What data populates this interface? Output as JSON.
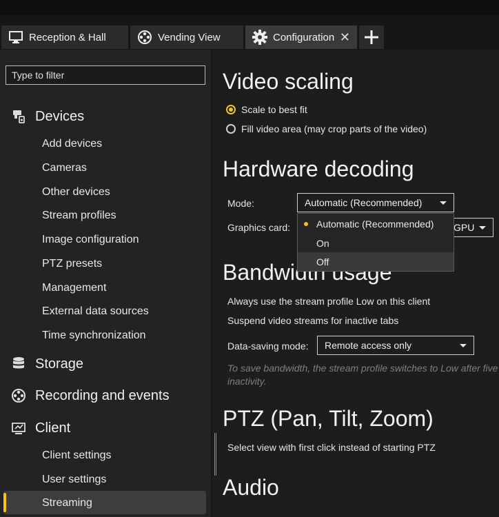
{
  "tabs": [
    {
      "label": "Reception & Hall",
      "icon": "monitor-icon"
    },
    {
      "label": "Vending View",
      "icon": "film-reel-icon"
    },
    {
      "label": "Configuration",
      "icon": "gear-icon",
      "active": true
    }
  ],
  "sidebar": {
    "filter_placeholder": "Type to filter",
    "sections": {
      "devices": {
        "label": "Devices",
        "items": [
          "Add devices",
          "Cameras",
          "Other devices",
          "Stream profiles",
          "Image configuration",
          "PTZ presets",
          "Management",
          "External data sources",
          "Time synchronization"
        ]
      },
      "storage": {
        "label": "Storage"
      },
      "recording": {
        "label": "Recording and events"
      },
      "client": {
        "label": "Client",
        "items": [
          "Client settings",
          "User settings",
          "Streaming"
        ],
        "selected": "Streaming"
      }
    }
  },
  "main": {
    "video_scaling": {
      "title": "Video scaling",
      "options": [
        "Scale to best fit",
        "Fill video area (may crop parts of the video)"
      ],
      "selected": "Scale to best fit"
    },
    "hardware_decoding": {
      "title": "Hardware decoding",
      "mode_label": "Mode:",
      "mode_value": "Automatic (Recommended)",
      "graphics_card_label": "Graphics card:",
      "graphics_card_value": "GPU",
      "dropdown_options": [
        "Automatic (Recommended)",
        "On",
        "Off"
      ],
      "dropdown_selected": "Automatic (Recommended)",
      "dropdown_hovered": "Off"
    },
    "bandwidth": {
      "title": "Bandwidth usage",
      "option1": "Always use the stream profile Low on this client",
      "option2": "Suspend video streams for inactive tabs",
      "data_saving_label": "Data-saving mode:",
      "data_saving_value": "Remote access only",
      "hint": "To save bandwidth, the stream profile switches to Low after five inactivity."
    },
    "ptz": {
      "title": "PTZ (Pan, Tilt, Zoom)",
      "option": "Select view with first click instead of starting PTZ"
    },
    "audio": {
      "title": "Audio"
    }
  },
  "colors": {
    "accent": "#f3c21b",
    "sidebar_bg": "#232323",
    "main_bg": "#1d1d1d"
  }
}
